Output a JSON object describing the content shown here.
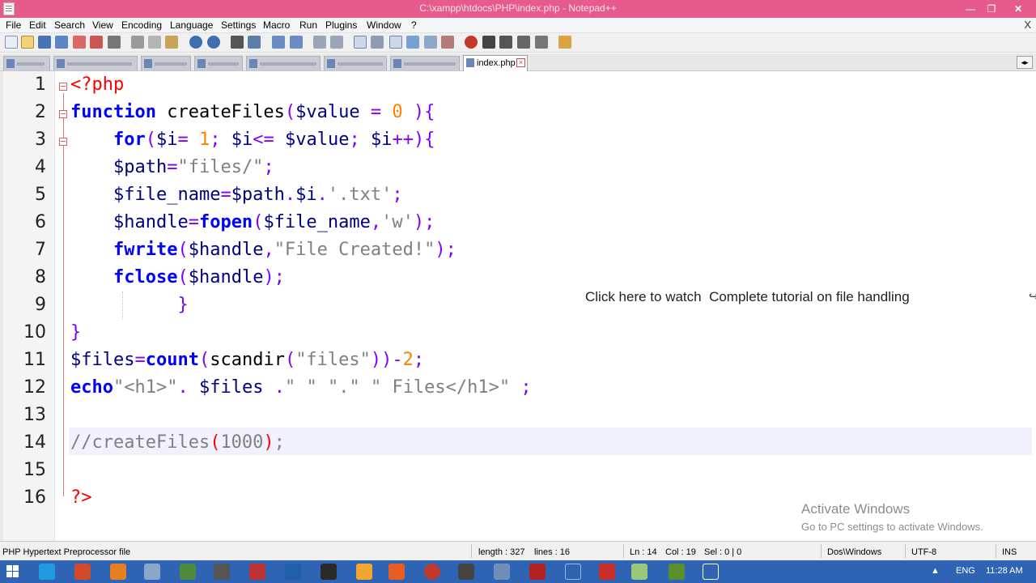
{
  "window": {
    "title": "C:\\xampp\\htdocs\\PHP\\index.php - Notepad++",
    "controls": [
      "minimize",
      "maximize",
      "close"
    ]
  },
  "menu": [
    "File",
    "Edit",
    "Search",
    "View",
    "Encoding",
    "Language",
    "Settings",
    "Macro",
    "Run",
    "Plugins",
    "Window",
    "?"
  ],
  "menu_close": "X",
  "active_tab": {
    "label": "index.php",
    "close_glyph": "⊠"
  },
  "tab_scroll_glyph": "◂▸",
  "editor": {
    "line_numbers": [
      "1",
      "2",
      "3",
      "4",
      "5",
      "6",
      "7",
      "8",
      "9",
      "10",
      "11",
      "12",
      "13",
      "14",
      "15",
      "16"
    ],
    "current_line": 14
  },
  "overlay": {
    "text_1": "Click here to watch",
    "text_2": "Complete tutorial on file handling",
    "icon": "share-icon"
  },
  "watermark": {
    "title": "Activate Windows",
    "subtitle": "Go to PC settings to activate Windows."
  },
  "status": {
    "file_type": "PHP Hypertext Preprocessor file",
    "length": "length : 327",
    "lines": "lines : 16",
    "ln": "Ln : 14",
    "col": "Col : 19",
    "sel": "Sel : 0 | 0",
    "eol": "Dos\\Windows",
    "encoding": "UTF-8",
    "mode": "INS"
  },
  "taskbar": {
    "language": "ENG",
    "time": "11:28 AM"
  }
}
